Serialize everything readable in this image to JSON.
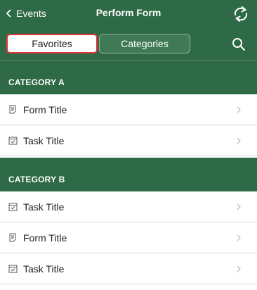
{
  "header": {
    "back_label": "Events",
    "title": "Perform Form",
    "refresh_icon": "refresh-icon",
    "search_icon": "search-icon",
    "color": "#2e6a45"
  },
  "segmented": {
    "favorites": "Favorites",
    "categories": "Categories",
    "selected": "Favorites",
    "highlight_color": "#e0353b"
  },
  "sections": [
    {
      "title": "CATEGORY A",
      "items": [
        {
          "label": "Form Title",
          "icon": "form-icon"
        },
        {
          "label": "Task Title",
          "icon": "task-icon"
        }
      ]
    },
    {
      "title": "CATEGORY B",
      "items": [
        {
          "label": "Task Title",
          "icon": "task-icon"
        },
        {
          "label": "Form Title",
          "icon": "form-icon"
        },
        {
          "label": "Task Title",
          "icon": "task-icon"
        }
      ]
    }
  ]
}
